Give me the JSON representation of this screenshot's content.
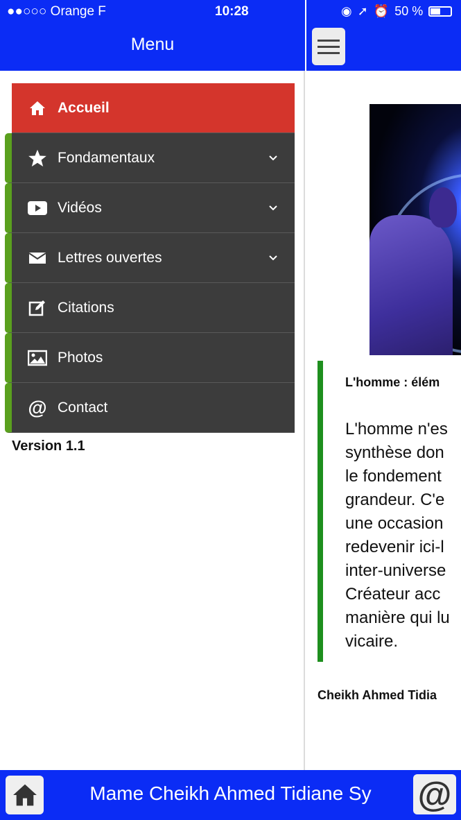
{
  "status": {
    "carrier": "●●○○○ Orange F",
    "time": "10:28",
    "battery": "50 %"
  },
  "drawer": {
    "title": "Menu",
    "items": [
      {
        "label": "Accueil",
        "icon": "home-icon",
        "active": true,
        "expandable": false
      },
      {
        "label": "Fondamentaux",
        "icon": "star-icon",
        "active": false,
        "expandable": true
      },
      {
        "label": "Vidéos",
        "icon": "youtube-icon",
        "active": false,
        "expandable": true
      },
      {
        "label": "Lettres ouvertes",
        "icon": "envelope-icon",
        "active": false,
        "expandable": true
      },
      {
        "label": "Citations",
        "icon": "edit-icon",
        "active": false,
        "expandable": false
      },
      {
        "label": "Photos",
        "icon": "image-icon",
        "active": false,
        "expandable": false
      },
      {
        "label": "Contact",
        "icon": "at-icon",
        "active": false,
        "expandable": false
      }
    ],
    "version": "Version 1.1"
  },
  "content": {
    "quote_title": "L'homme : élém",
    "quote_lines": [
      "L'homme n'es",
      "synthèse don",
      "le  fondement",
      "grandeur.  C'e",
      "une occasion",
      "redevenir  ici-l",
      "inter-universe",
      "Créateur  acc",
      "manière  qui  lu",
      "vicaire."
    ],
    "author": "Cheikh Ahmed Tidia"
  },
  "bottom_bar": {
    "title": "Mame Cheikh Ahmed Tidiane Sy",
    "contact_symbol": "@"
  },
  "colors": {
    "header_blue": "#0b2cf5",
    "active_red": "#d4352c",
    "menu_dark": "#3c3c3c",
    "accent_green": "#5aa01e",
    "quote_green": "#1e8f1e"
  }
}
